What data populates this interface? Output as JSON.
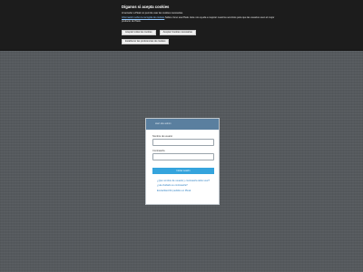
{
  "cookie_banner": {
    "title": "Díganos si acepta cookies",
    "intro": "Al acceder a Plesk no permite usar las cookies necesarias.",
    "policy_link": "Información sobre la recogida de cookies",
    "body": "Sobre cómo usa Plesk. Este nos ayuda a mejorar nuestros servicios para que las usuarios usen el mejor producto de Plesk.",
    "accept_all": "Aceptar todas las cookies",
    "accept_necessary": "Aceptar Cookies necesarias",
    "settings": "Establecer las preferencias de cookies"
  },
  "login": {
    "header": "start site admin",
    "username_label": "Nombre de usuario",
    "username_value": "",
    "password_label": "Contraseña",
    "password_value": "",
    "submit": "Iniciar sesión",
    "links": [
      "¿Qué nombre de usuario y contraseña debo usar?",
      "¿Ha olvidado su contraseña?",
      "Enviar/Escribir pedidos en Plesk"
    ]
  },
  "colors": {
    "background": "#55595d",
    "banner": "#1c1c1c",
    "header": "#5a7f9f",
    "primary": "#35a4dd",
    "link": "#2b7fc2"
  }
}
